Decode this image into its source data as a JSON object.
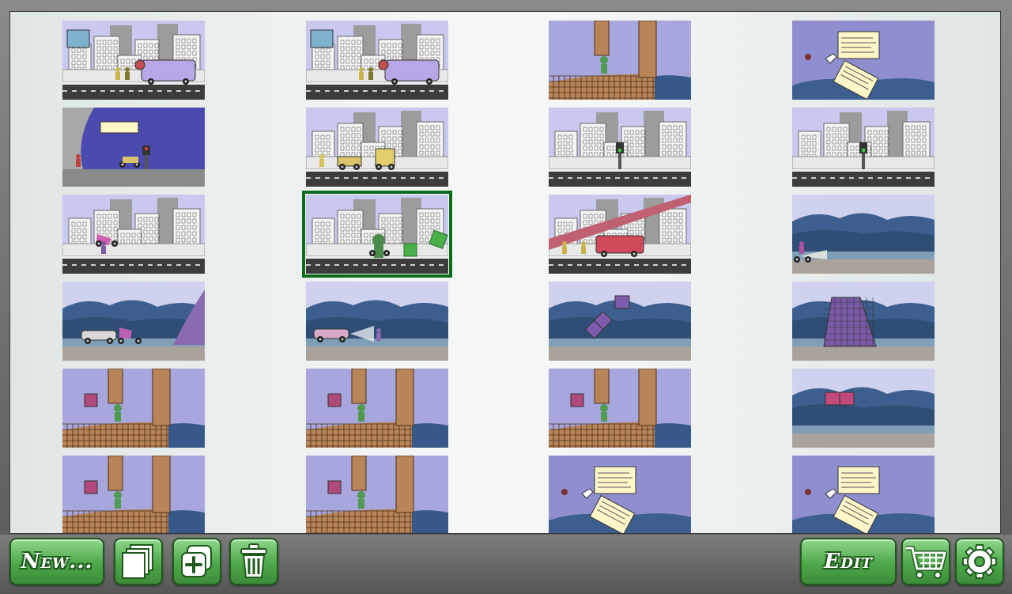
{
  "toolbar": {
    "new_label": "New...",
    "edit_label": "Edit"
  },
  "icons": {
    "duplicate": "stacked-pages-icon",
    "add": "add-page-icon",
    "delete": "trash-icon",
    "cart": "shopping-cart-icon",
    "settings": "gear-icon"
  },
  "colors": {
    "accent": "#4ea84a",
    "selection": "#0d6b1c",
    "sky_city": "#c9c9ef",
    "sky_purple": "#8f8fd0"
  },
  "thumbnails": [
    {
      "scene": "city-signs"
    },
    {
      "scene": "city-signs"
    },
    {
      "scene": "bricks-tall"
    },
    {
      "scene": "notes"
    },
    {
      "scene": "ramp-dark"
    },
    {
      "scene": "city-cars"
    },
    {
      "scene": "city-light"
    },
    {
      "scene": "city-light"
    },
    {
      "scene": "city-bike"
    },
    {
      "scene": "city-green",
      "selected": true
    },
    {
      "scene": "city-bus"
    },
    {
      "scene": "lake-bike"
    },
    {
      "scene": "lake-cars"
    },
    {
      "scene": "lake-car"
    },
    {
      "scene": "lake-blocks"
    },
    {
      "scene": "lake-pyramid"
    },
    {
      "scene": "bricks"
    },
    {
      "scene": "bricks"
    },
    {
      "scene": "bricks"
    },
    {
      "scene": "lake-pink"
    },
    {
      "scene": "bricks"
    },
    {
      "scene": "bricks"
    },
    {
      "scene": "notes"
    },
    {
      "scene": "notes"
    }
  ]
}
